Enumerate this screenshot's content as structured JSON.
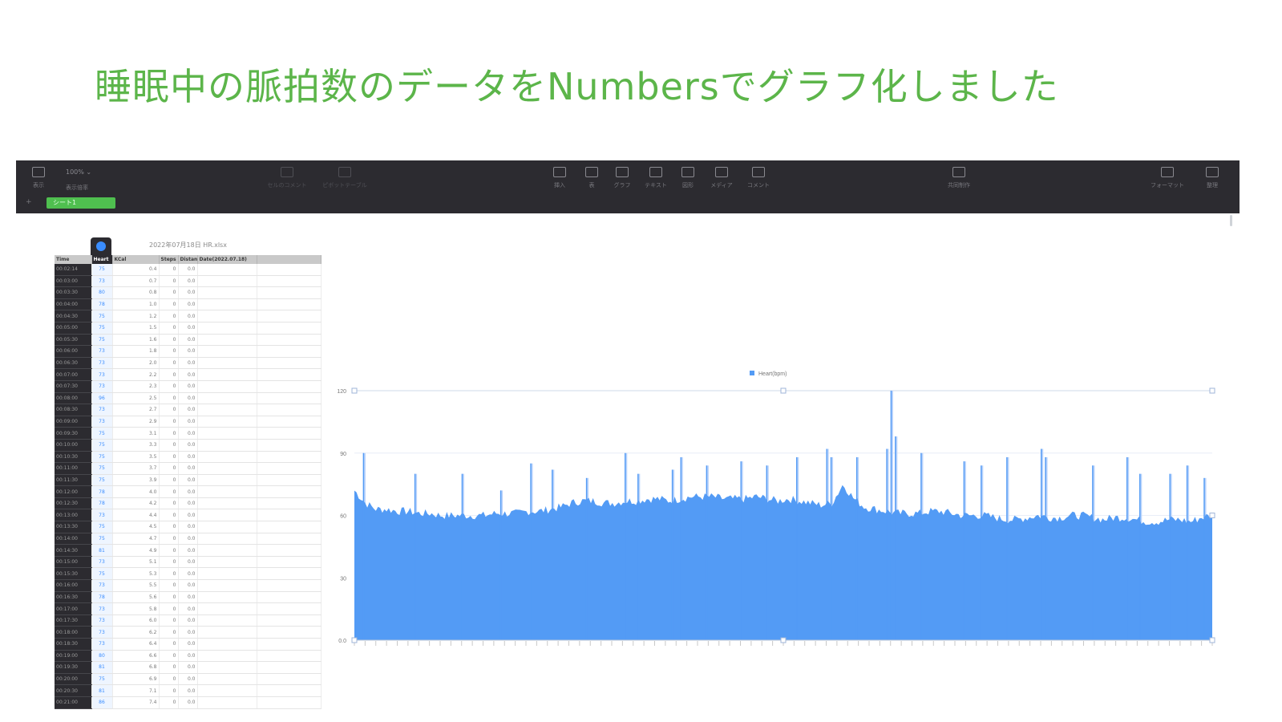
{
  "headline": "睡眠中の脈拍数のデータをNumbersでグラフ化しました",
  "toolbar": {
    "zoom": "100% ⌄",
    "left_buttons": [
      "表示",
      "表示倍率"
    ],
    "mid_dim_buttons": [
      "セルのコメント",
      "ピボットテーブル"
    ],
    "insert_buttons": [
      "挿入",
      "表",
      "グラフ",
      "テキスト",
      "図形",
      "メディア",
      "コメント"
    ],
    "share": "共同制作",
    "right_buttons": [
      "フォーマット",
      "整理"
    ],
    "sheet_add": "+",
    "sheet_tab": "シート1"
  },
  "table": {
    "title": "2022年07月18日 HR.xlsx",
    "headers": [
      "Time",
      "Heart",
      "KCal",
      "Steps",
      "Distance",
      "Date(2022.07.18)",
      ""
    ],
    "rows": [
      [
        "00:02:14",
        "75",
        "0.4",
        "0",
        "0.0",
        "",
        ""
      ],
      [
        "00:03:00",
        "73",
        "0.7",
        "0",
        "0.0",
        "",
        ""
      ],
      [
        "00:03:30",
        "80",
        "0.8",
        "0",
        "0.0",
        "",
        ""
      ],
      [
        "00:04:00",
        "78",
        "1.0",
        "0",
        "0.0",
        "",
        ""
      ],
      [
        "00:04:30",
        "75",
        "1.2",
        "0",
        "0.0",
        "",
        ""
      ],
      [
        "00:05:00",
        "75",
        "1.5",
        "0",
        "0.0",
        "",
        ""
      ],
      [
        "00:05:30",
        "75",
        "1.6",
        "0",
        "0.0",
        "",
        ""
      ],
      [
        "00:06:00",
        "73",
        "1.8",
        "0",
        "0.0",
        "",
        ""
      ],
      [
        "00:06:30",
        "73",
        "2.0",
        "0",
        "0.0",
        "",
        ""
      ],
      [
        "00:07:00",
        "73",
        "2.2",
        "0",
        "0.0",
        "",
        ""
      ],
      [
        "00:07:30",
        "73",
        "2.3",
        "0",
        "0.0",
        "",
        ""
      ],
      [
        "00:08:00",
        "96",
        "2.5",
        "0",
        "0.0",
        "",
        ""
      ],
      [
        "00:08:30",
        "73",
        "2.7",
        "0",
        "0.0",
        "",
        ""
      ],
      [
        "00:09:00",
        "73",
        "2.9",
        "0",
        "0.0",
        "",
        ""
      ],
      [
        "00:09:30",
        "75",
        "3.1",
        "0",
        "0.0",
        "",
        ""
      ],
      [
        "00:10:00",
        "75",
        "3.3",
        "0",
        "0.0",
        "",
        ""
      ],
      [
        "00:10:30",
        "75",
        "3.5",
        "0",
        "0.0",
        "",
        ""
      ],
      [
        "00:11:00",
        "75",
        "3.7",
        "0",
        "0.0",
        "",
        ""
      ],
      [
        "00:11:30",
        "75",
        "3.9",
        "0",
        "0.0",
        "",
        ""
      ],
      [
        "00:12:00",
        "78",
        "4.0",
        "0",
        "0.0",
        "",
        ""
      ],
      [
        "00:12:30",
        "78",
        "4.2",
        "0",
        "0.0",
        "",
        ""
      ],
      [
        "00:13:00",
        "73",
        "4.4",
        "0",
        "0.0",
        "",
        ""
      ],
      [
        "00:13:30",
        "75",
        "4.5",
        "0",
        "0.0",
        "",
        ""
      ],
      [
        "00:14:00",
        "75",
        "4.7",
        "0",
        "0.0",
        "",
        ""
      ],
      [
        "00:14:30",
        "81",
        "4.9",
        "0",
        "0.0",
        "",
        ""
      ],
      [
        "00:15:00",
        "73",
        "5.1",
        "0",
        "0.0",
        "",
        ""
      ],
      [
        "00:15:30",
        "75",
        "5.3",
        "0",
        "0.0",
        "",
        ""
      ],
      [
        "00:16:00",
        "73",
        "5.5",
        "0",
        "0.0",
        "",
        ""
      ],
      [
        "00:16:30",
        "78",
        "5.6",
        "0",
        "0.0",
        "",
        ""
      ],
      [
        "00:17:00",
        "73",
        "5.8",
        "0",
        "0.0",
        "",
        ""
      ],
      [
        "00:17:30",
        "73",
        "6.0",
        "0",
        "0.0",
        "",
        ""
      ],
      [
        "00:18:00",
        "73",
        "6.2",
        "0",
        "0.0",
        "",
        ""
      ],
      [
        "00:18:30",
        "73",
        "6.4",
        "0",
        "0.0",
        "",
        ""
      ],
      [
        "00:19:00",
        "80",
        "6.6",
        "0",
        "0.0",
        "",
        ""
      ],
      [
        "00:19:30",
        "81",
        "6.8",
        "0",
        "0.0",
        "",
        ""
      ],
      [
        "00:20:00",
        "75",
        "6.9",
        "0",
        "0.0",
        "",
        ""
      ],
      [
        "00:20:30",
        "81",
        "7.1",
        "0",
        "0.0",
        "",
        ""
      ],
      [
        "00:21:00",
        "86",
        "7.4",
        "0",
        "0.0",
        "",
        ""
      ]
    ]
  },
  "chart_data": {
    "type": "area",
    "legend": "Heart(bpm)",
    "legend_position": "top-center",
    "color": "#539bf5",
    "ylim": [
      0,
      120
    ],
    "yticks": [
      "0.0",
      "30",
      "60",
      "90",
      "120"
    ],
    "x_count": 400,
    "x_labels_note": "tick labels along x axis are illegible",
    "series": [
      {
        "name": "Heart(bpm)",
        "baseline_profile": [
          72,
          66,
          63,
          63,
          62,
          62,
          61,
          61,
          60,
          60,
          60,
          60,
          60,
          61,
          61,
          61,
          62,
          62,
          63,
          64,
          66,
          67,
          67,
          66,
          66,
          67,
          67,
          68,
          68,
          67,
          68,
          69,
          69,
          69,
          68,
          68,
          68,
          69,
          68,
          67,
          68,
          67,
          66,
          65,
          66,
          75,
          68,
          64,
          63,
          62,
          61,
          61,
          61,
          62,
          62,
          61,
          60,
          60,
          60,
          59,
          58,
          58,
          59,
          60,
          59,
          59,
          60,
          60,
          59,
          58,
          59,
          59,
          58,
          57,
          57,
          58,
          58,
          57,
          59,
          60
        ],
        "spikes": [
          [
            0.01,
            90
          ],
          [
            0.07,
            80
          ],
          [
            0.125,
            80
          ],
          [
            0.17,
            72
          ],
          [
            0.205,
            85
          ],
          [
            0.23,
            82
          ],
          [
            0.27,
            78
          ],
          [
            0.315,
            90
          ],
          [
            0.33,
            80
          ],
          [
            0.37,
            82
          ],
          [
            0.38,
            88
          ],
          [
            0.41,
            84
          ],
          [
            0.45,
            86
          ],
          [
            0.48,
            84
          ],
          [
            0.515,
            88
          ],
          [
            0.55,
            92
          ],
          [
            0.555,
            88
          ],
          [
            0.585,
            88
          ],
          [
            0.62,
            92
          ],
          [
            0.625,
            120
          ],
          [
            0.63,
            98
          ],
          [
            0.66,
            90
          ],
          [
            0.71,
            86
          ],
          [
            0.73,
            84
          ],
          [
            0.76,
            88
          ],
          [
            0.8,
            92
          ],
          [
            0.805,
            88
          ],
          [
            0.86,
            84
          ],
          [
            0.9,
            88
          ],
          [
            0.915,
            80
          ],
          [
            0.95,
            80
          ],
          [
            0.97,
            84
          ],
          [
            0.99,
            78
          ]
        ]
      }
    ]
  }
}
